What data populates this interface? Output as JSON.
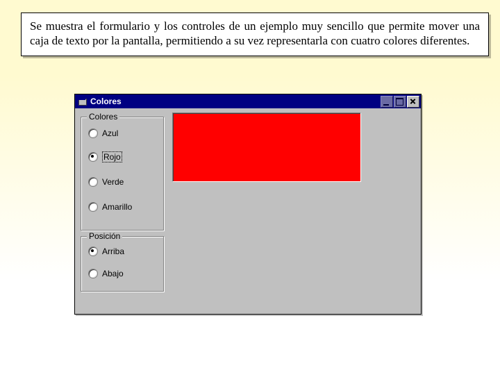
{
  "description": "Se muestra el formulario y los controles de un ejemplo muy sencillo que permite mover una caja de texto por la pantalla, permitiendo a su vez representarla con cuatro colores diferentes.",
  "window": {
    "title": "Colores",
    "groups": {
      "colores": {
        "legend": "Colores",
        "options": {
          "azul": "Azul",
          "rojo": "Rojo",
          "verde": "Verde",
          "amarillo": "Amarillo"
        },
        "selected": "rojo"
      },
      "posicion": {
        "legend": "Posición",
        "options": {
          "arriba": "Arriba",
          "abajo": "Abajo"
        },
        "selected": "arriba"
      }
    },
    "panel_color": "#ff0000"
  }
}
